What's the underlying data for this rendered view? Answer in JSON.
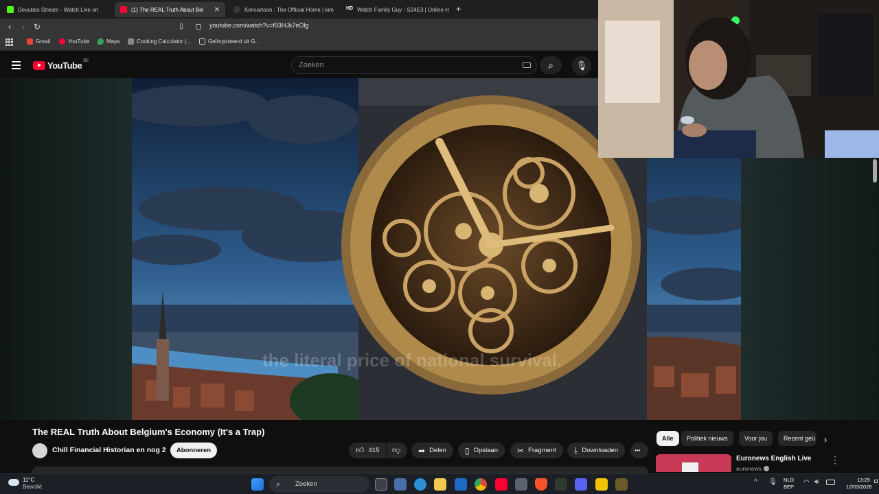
{
  "browser": {
    "tabs": [
      {
        "label": "Devubbs Stream - Watch Live on",
        "favicon": "kick-icon",
        "color": "#53fc18"
      },
      {
        "label": "(1) The REAL Truth About Bel",
        "favicon": "youtube-icon",
        "color": "#ff0033",
        "active": true
      },
      {
        "label": "Kimcartoon : The Official Home | kim",
        "favicon": "kimcartoon-icon",
        "color": "#3a3a3a"
      },
      {
        "label": "Watch Family Guy - S24E3 | Online H",
        "favicon": "hd-icon",
        "color": "#ffffff",
        "badge": "HD"
      }
    ],
    "new_tab": "+",
    "url": "youtube.com/watch?v=f93HJk7eOlg",
    "bookmarks": [
      {
        "label": "Gmail",
        "icon": "gmail-icon",
        "color": "#ea4335"
      },
      {
        "label": "YouTube",
        "icon": "youtube-icon",
        "color": "#ff0033"
      },
      {
        "label": "Maps",
        "icon": "maps-icon",
        "color": "#34a853"
      },
      {
        "label": "Cooking Calculator |...",
        "icon": "calculator-icon",
        "color": "#888888"
      },
      {
        "label": "Geïmporteerd uit G...",
        "icon": "folder-icon",
        "color": "#cccccc"
      }
    ]
  },
  "youtube": {
    "logo_text": "YouTube",
    "country": "BE",
    "search_placeholder": "Zoeken",
    "video": {
      "subtitle": "the literal price of national survival."
    },
    "title": "The REAL Truth About Belgium's Economy (It's a Trap)",
    "channel": "Chill Financial Historian en nog 2",
    "subscribe": "Abonneren",
    "likes": "415",
    "share": "Delen",
    "save": "Opslaan",
    "clip": "Fragment",
    "download": "Downloaden",
    "more": "•••",
    "chips": [
      "Alle",
      "Politiek nieuws",
      "Voor jou",
      "Recent geü"
    ],
    "next_video": {
      "title": "Euronews English Live",
      "channel": "euronews"
    }
  },
  "taskbar": {
    "weather_temp": "11°C",
    "weather_text": "Bewolkt",
    "search": "Zoeken",
    "lang_top": "NLD",
    "lang_bottom": "BEP",
    "time": "13:29",
    "date": "12/03/2026"
  },
  "colors": {
    "bg": "#0f0f0f",
    "accent": "#ff0033",
    "chrome": "#353535"
  }
}
